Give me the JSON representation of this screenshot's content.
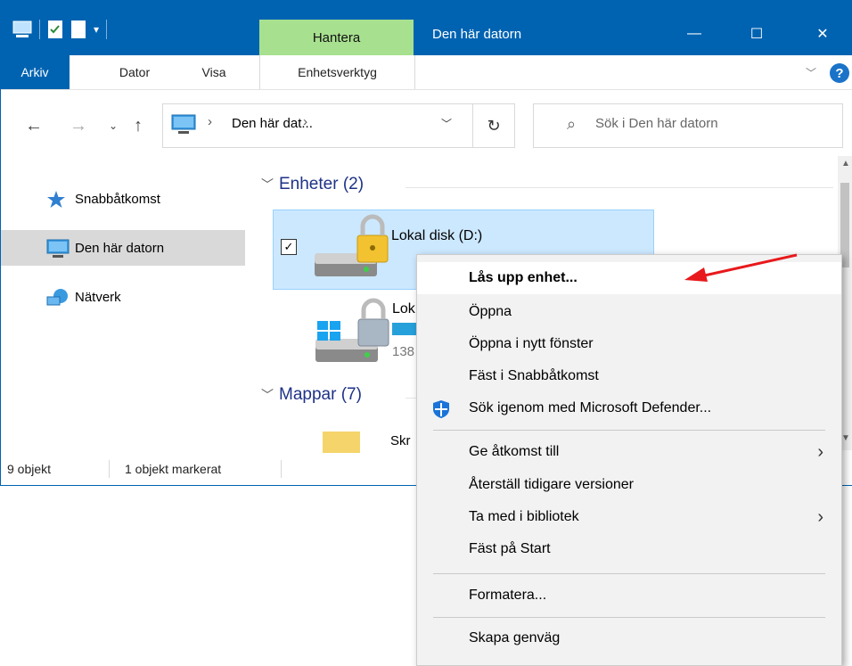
{
  "window": {
    "title": "Den här datorn",
    "manage_tab": "Hantera",
    "buttons": {
      "minimize": "—",
      "maximize": "☐",
      "close": "✕"
    }
  },
  "ribbon": {
    "tabs": [
      "Arkiv",
      "Dator",
      "Visa",
      "Enhetsverktyg"
    ],
    "help": "?"
  },
  "address": {
    "path": "Den här dat...",
    "sep": "›",
    "search_placeholder": "Sök i Den här datorn"
  },
  "nav": {
    "items": [
      "Snabbåtkomst",
      "Den här datorn",
      "Nätverk"
    ]
  },
  "content": {
    "groups": [
      {
        "label": "Enheter (2)"
      },
      {
        "label": "Mappar (7)"
      }
    ],
    "drives": [
      {
        "name": "Lokal disk (D:)",
        "selected": true
      },
      {
        "name_partial": "Lok",
        "size_partial": "138"
      }
    ],
    "folder_partial": "Skr"
  },
  "status": {
    "count": "9 objekt",
    "selected": "1 objekt markerat"
  },
  "context_menu": {
    "items": [
      {
        "label": "Lås upp enhet...",
        "bold": true
      },
      {
        "label": "Öppna"
      },
      {
        "label": "Öppna i nytt fönster"
      },
      {
        "label": "Fäst i Snabbåtkomst"
      },
      {
        "label": "Sök igenom med Microsoft Defender...",
        "icon": "defender-icon"
      },
      {
        "label": "Ge åtkomst till",
        "submenu": true
      },
      {
        "label": "Återställ tidigare versioner"
      },
      {
        "label": "Ta med i bibliotek",
        "submenu": true
      },
      {
        "label": "Fäst på Start"
      },
      {
        "label": "Formatera..."
      },
      {
        "label": "Skapa genväg"
      }
    ]
  },
  "colors": {
    "title_blue": "#0063b1",
    "manage_green": "#a7e08f",
    "selection": "#cce8ff",
    "group_header": "#1e3287",
    "annotation_arrow": "#e8191c"
  }
}
